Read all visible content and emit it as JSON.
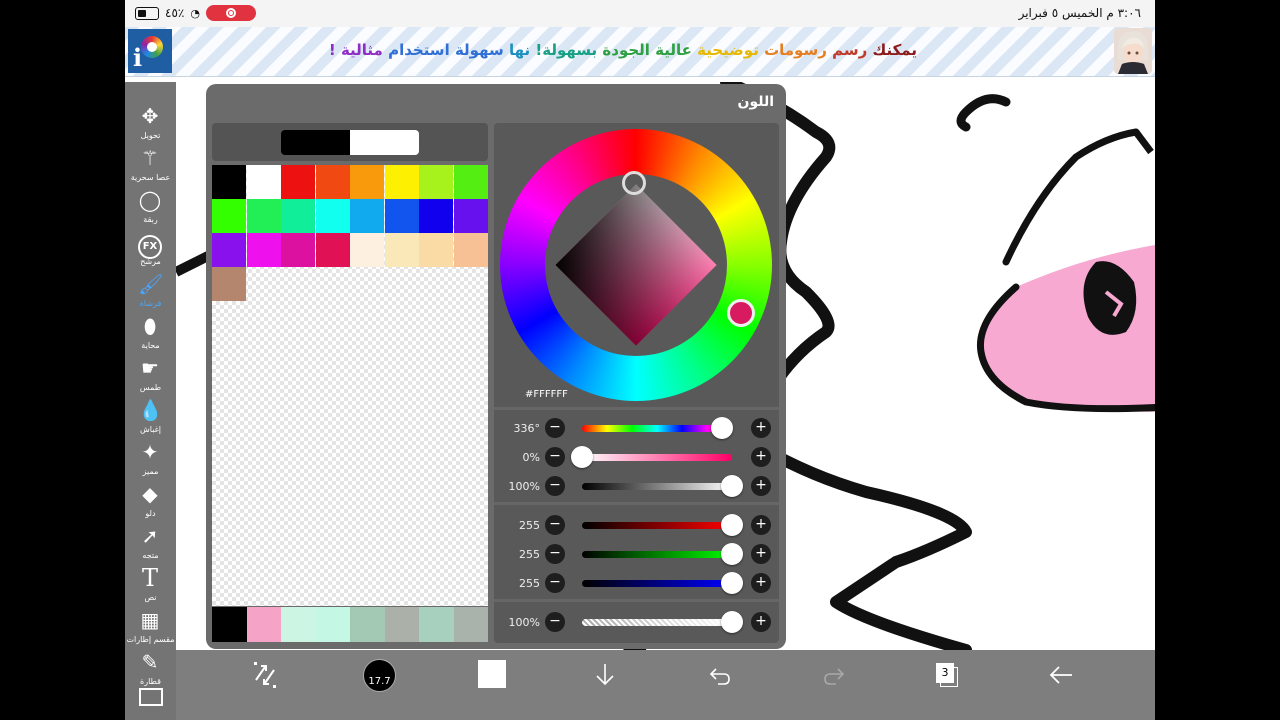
{
  "status_bar": {
    "time_date": "٣:٠٦ م   الخميس ٥ فبراير",
    "battery": "٤٥٪"
  },
  "ad_banner": {
    "segments": [
      {
        "text": "يمكنك",
        "color": "#8b1a1a"
      },
      {
        "text": "رسم",
        "color": "#c0392b"
      },
      {
        "text": "رسومات",
        "color": "#e67e22"
      },
      {
        "text": "توضيحية",
        "color": "#e6b800"
      },
      {
        "text": "عالية الجودة",
        "color": "#2ea043"
      },
      {
        "text": "بسهولة!",
        "color": "#16a085"
      },
      {
        "text": "نها",
        "color": "#1f8fbf"
      },
      {
        "text": "سهولة",
        "color": "#2f6fd6"
      },
      {
        "text": "استخدام",
        "color": "#2f6fd6"
      },
      {
        "text": "مثالية !",
        "color": "#8e2ec4"
      }
    ]
  },
  "toolbar": {
    "tools": [
      {
        "name": "transform",
        "label": "تحويل",
        "icon": "move-icon"
      },
      {
        "name": "magic-wand",
        "label": "عصا سحرية",
        "icon": "magic-wand-icon"
      },
      {
        "name": "lasso",
        "label": "ربقة",
        "icon": "lasso-icon"
      },
      {
        "name": "filter",
        "label": "مرشح",
        "icon": "fx-icon"
      },
      {
        "name": "brush",
        "label": "فرشاة",
        "icon": "brush-icon"
      },
      {
        "name": "eraser",
        "label": "محاية",
        "icon": "eraser-icon"
      },
      {
        "name": "smudge",
        "label": "طمس",
        "icon": "smudge-icon"
      },
      {
        "name": "blur",
        "label": "إغباش",
        "icon": "blur-icon"
      },
      {
        "name": "special",
        "label": "مميز",
        "icon": "sparkle-icon"
      },
      {
        "name": "fill",
        "label": "دلو",
        "icon": "bucket-icon"
      },
      {
        "name": "select",
        "label": "متجه",
        "icon": "arrow-cursor-icon"
      },
      {
        "name": "text",
        "label": "نص",
        "icon": "text-icon"
      },
      {
        "name": "frame-divider",
        "label": "مقسم إطارات",
        "icon": "frame-divider-icon"
      },
      {
        "name": "eyedropper",
        "label": "قطارة",
        "icon": "eyedropper-icon"
      }
    ]
  },
  "color_panel": {
    "title": "اللون",
    "hex": "#FFFFFF",
    "colors": {
      "current": "#000000",
      "previous": "#ffffff"
    },
    "palette": [
      "#000000",
      "#ffffff",
      "#ee1111",
      "#f04a12",
      "#f99a0d",
      "#fdf000",
      "#a7f21c",
      "#55ee12",
      "#33ff00",
      "#22ee55",
      "#11ee99",
      "#11ffee",
      "#11aaee",
      "#1155ee",
      "#1100ee",
      "#6611ee",
      "#8811ee",
      "#ee11ee",
      "#dd11a0",
      "#e11155",
      "#fdf0e0",
      "#fbe8b8",
      "#fadaa5",
      "#f7c195",
      "#b5866e"
    ],
    "history": [
      "#000000",
      "#f5a3c6",
      "#ccf5e4",
      "#c5f8e4",
      "#a3c8b3",
      "#abb1a8",
      "#a8d0be",
      "#a9b3ac"
    ],
    "sliders": [
      {
        "name": "hue",
        "value": "336°",
        "level": 0.93,
        "track": "linear-gradient(90deg,#f00,#ff0,#0f0,#0ff,#00f,#f0f,#f00)"
      },
      {
        "name": "saturation",
        "value": "0%",
        "level": 0.0,
        "track": "linear-gradient(90deg,#fff,#ff0066)"
      },
      {
        "name": "brightness",
        "value": "100%",
        "level": 1.0,
        "track": "linear-gradient(90deg,#000,#fff)"
      },
      {
        "name": "red",
        "value": "255",
        "level": 1.0,
        "track": "linear-gradient(90deg,#000,#ff0000)"
      },
      {
        "name": "green",
        "value": "255",
        "level": 1.0,
        "track": "linear-gradient(90deg,#000,#00ff00)"
      },
      {
        "name": "blue",
        "value": "255",
        "level": 1.0,
        "track": "linear-gradient(90deg,#000,#0000ff)"
      },
      {
        "name": "opacity",
        "value": "100%",
        "level": 1.0,
        "track": "opacity-checker"
      }
    ]
  },
  "bottom_bar": {
    "brush_size": "17.7",
    "layer_count": "3"
  }
}
